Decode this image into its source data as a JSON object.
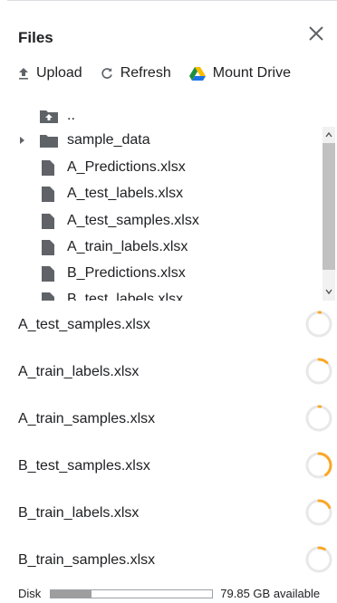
{
  "panel": {
    "title": "Files"
  },
  "toolbar": {
    "upload_label": "Upload",
    "refresh_label": "Refresh",
    "mount_label": "Mount Drive"
  },
  "tree": {
    "parent_label": "..",
    "items": [
      {
        "label": "sample_data",
        "type": "folder"
      },
      {
        "label": "A_Predictions.xlsx",
        "type": "file"
      },
      {
        "label": "A_test_labels.xlsx",
        "type": "file"
      },
      {
        "label": "A_test_samples.xlsx",
        "type": "file"
      },
      {
        "label": "A_train_labels.xlsx",
        "type": "file"
      },
      {
        "label": "B_Predictions.xlsx",
        "type": "file"
      },
      {
        "label": "B_test_labels.xlsx",
        "type": "file"
      }
    ]
  },
  "uploads": [
    {
      "name": "A_test_samples.xlsx",
      "progress": 0.02
    },
    {
      "name": "A_train_labels.xlsx",
      "progress": 0.12
    },
    {
      "name": "A_train_samples.xlsx",
      "progress": 0.02
    },
    {
      "name": "B_test_samples.xlsx",
      "progress": 0.4
    },
    {
      "name": "B_train_labels.xlsx",
      "progress": 0.18
    },
    {
      "name": "B_train_samples.xlsx",
      "progress": 0.08
    }
  ],
  "disk": {
    "label": "Disk",
    "available": "79.85 GB available",
    "used_fraction": 0.25
  },
  "colors": {
    "spinner_track": "#e8e8e8",
    "spinner_progress": "#f9a825",
    "icon": "#5f6368"
  }
}
